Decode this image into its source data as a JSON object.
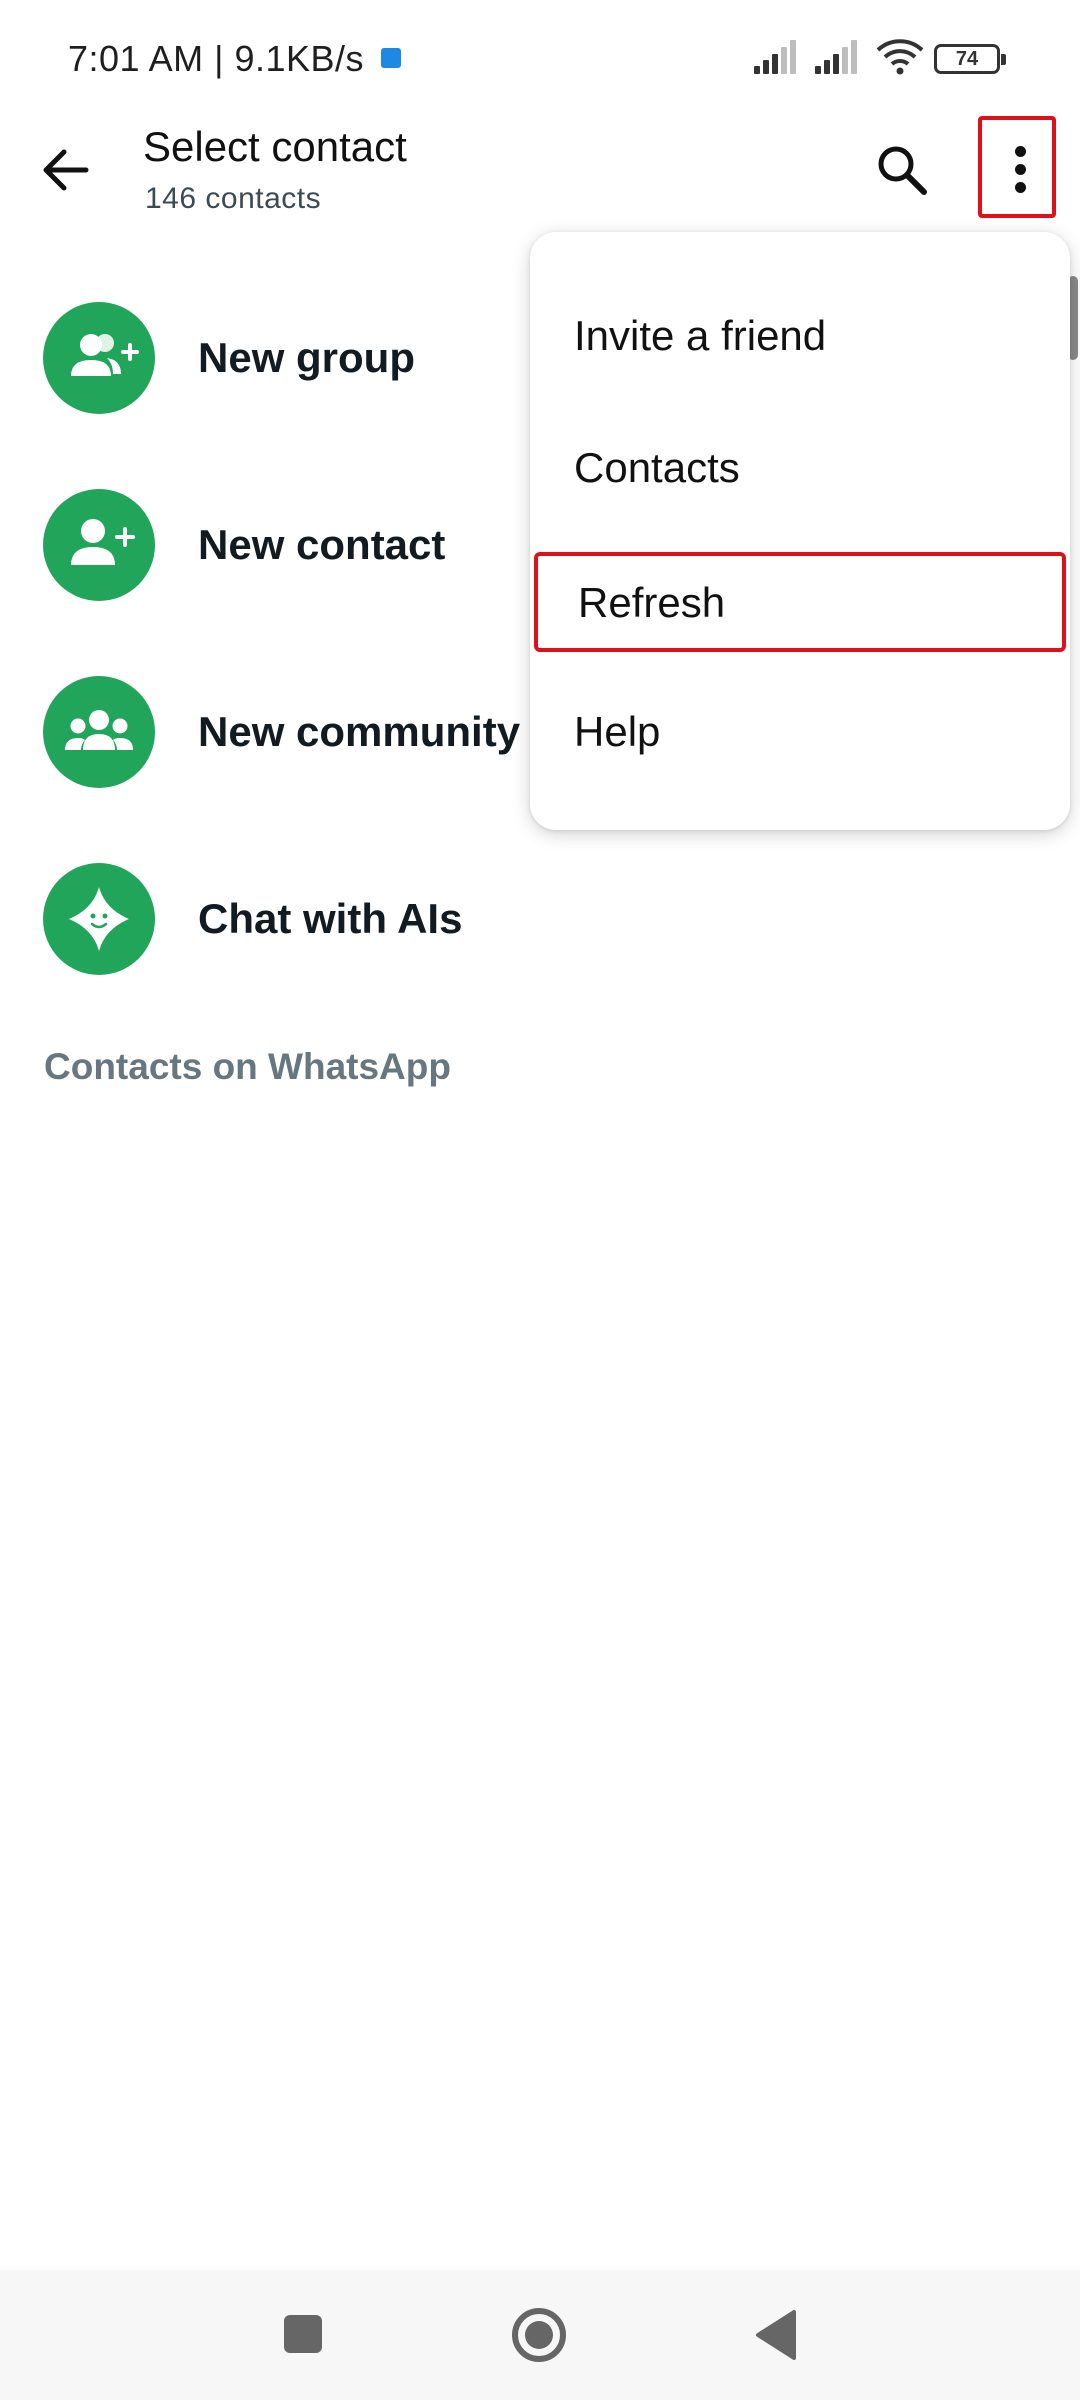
{
  "status_bar": {
    "time": "7:01 AM | 9.1KB/s",
    "battery": "74"
  },
  "app_bar": {
    "title": "Select contact",
    "subtitle": "146 contacts"
  },
  "actions": [
    {
      "label": "New group",
      "icon": "group-add-icon"
    },
    {
      "label": "New contact",
      "icon": "person-add-icon"
    },
    {
      "label": "New community",
      "icon": "community-icon"
    },
    {
      "label": "Chat with AIs",
      "icon": "ai-sparkle-icon"
    }
  ],
  "section_header": "Contacts on WhatsApp",
  "menu": {
    "items": [
      "Invite a friend",
      "Contacts",
      "Refresh",
      "Help"
    ],
    "highlighted": "Refresh"
  },
  "colors": {
    "accent": "#21a55a",
    "highlight_border": "#e0101a"
  }
}
